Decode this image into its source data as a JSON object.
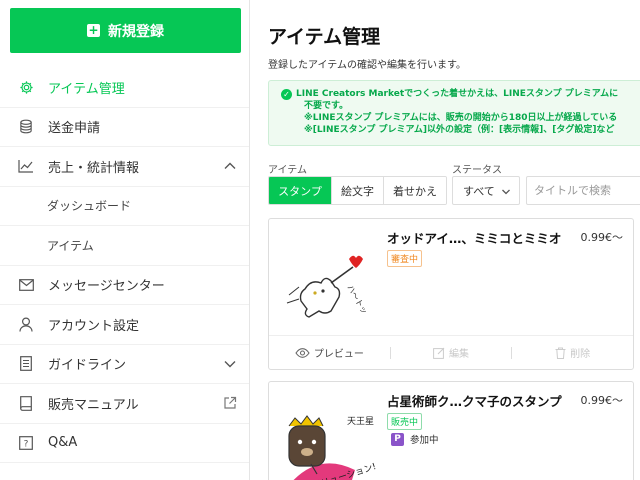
{
  "sidebar": {
    "new_button": "新規登録",
    "items": [
      {
        "label": "アイテム管理",
        "icon": "gear-icon",
        "active": true
      },
      {
        "label": "送金申請",
        "icon": "coins-icon"
      },
      {
        "label": "売上・統計情報",
        "icon": "chart-icon",
        "expanded": true
      },
      {
        "label": "ダッシュボード",
        "sub": true
      },
      {
        "label": "アイテム",
        "sub": true
      },
      {
        "label": "メッセージセンター",
        "icon": "mail-icon"
      },
      {
        "label": "アカウント設定",
        "icon": "user-icon"
      },
      {
        "label": "ガイドライン",
        "icon": "document-icon",
        "expandable": true
      },
      {
        "label": "販売マニュアル",
        "icon": "book-icon",
        "external": true
      },
      {
        "label": "Q&A",
        "icon": "question-icon"
      }
    ]
  },
  "main": {
    "title": "アイテム管理",
    "description": "登録したアイテムの確認や編集を行います。",
    "notice": {
      "line1": "LINE Creators Marketでつくった着せかえは、LINEスタンプ プレミアムに",
      "line2": "不要です。",
      "line3": "※LINEスタンプ プレミアムには、販売の開始から180日以上が経過している",
      "line4": "※[LINEスタンプ プレミアム]以外の設定（例：[表示情報]、[タグ設定]など"
    },
    "filters": {
      "item_label": "アイテム",
      "item_tabs": [
        "スタンプ",
        "絵文字",
        "着せかえ"
      ],
      "status_label": "ステータス",
      "status_value": "すべて",
      "search_placeholder": "タイトルで検索"
    },
    "cards": [
      {
        "name": "オッドアイ…、ミミコとミミオ",
        "price": "0.99€〜",
        "status": "審査中",
        "thumb_text": "ハ〜トッ",
        "actions": [
          "プレビュー",
          "編集",
          "削除"
        ]
      },
      {
        "name": "占星術師ク…クマ子のスタンプ",
        "price": "0.99€〜",
        "status": "販売中",
        "premium_badge": "P",
        "premium_label": "参加中",
        "thumb_text_top": "天王星",
        "thumb_text_bottom": "レボリューション!"
      }
    ]
  },
  "colors": {
    "accent": "#06c755",
    "review": "#f08a24",
    "premium": "#8a54c9"
  }
}
